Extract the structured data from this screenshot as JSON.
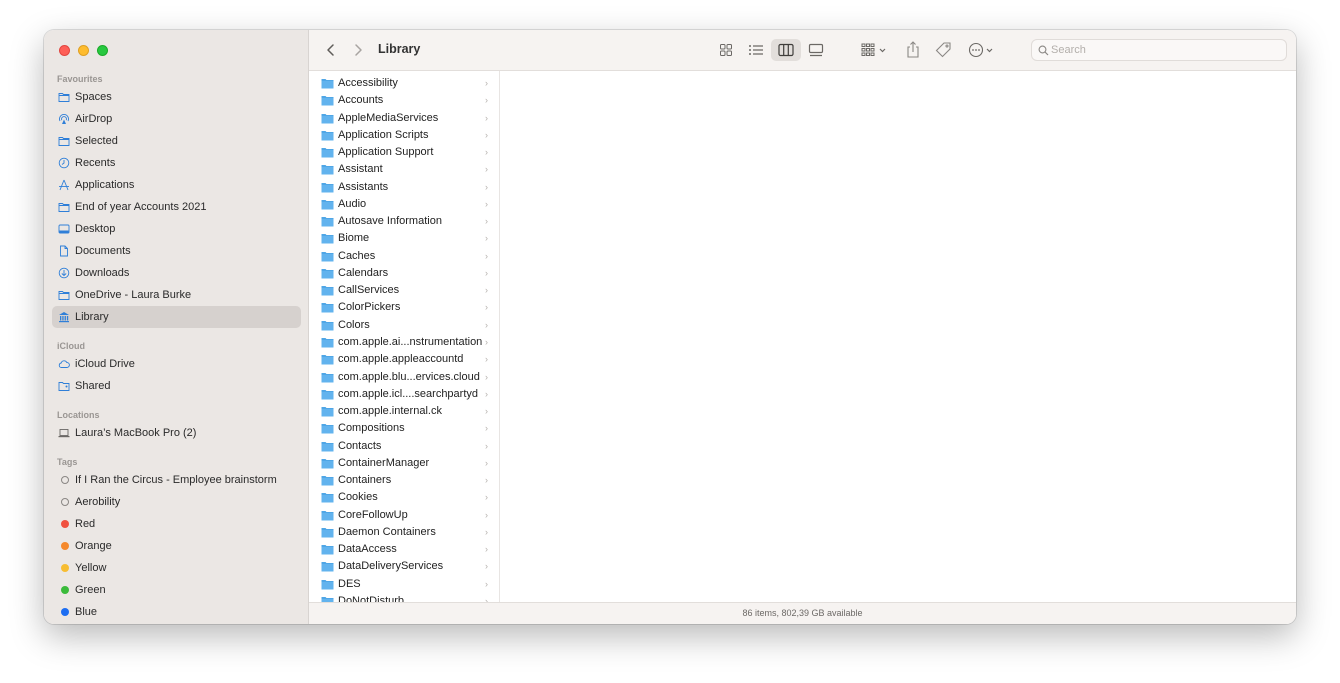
{
  "window": {
    "title": "Library"
  },
  "sidebar": {
    "favourites_heading": "Favourites",
    "favourites": [
      {
        "label": "Spaces",
        "icon": "folder-icon"
      },
      {
        "label": "AirDrop",
        "icon": "airdrop-icon"
      },
      {
        "label": "Selected",
        "icon": "folder-icon"
      },
      {
        "label": "Recents",
        "icon": "clock-icon"
      },
      {
        "label": "Applications",
        "icon": "applications-icon"
      },
      {
        "label": "End of year Accounts 2021",
        "icon": "folder-icon"
      },
      {
        "label": "Desktop",
        "icon": "desktop-icon"
      },
      {
        "label": "Documents",
        "icon": "document-icon"
      },
      {
        "label": "Downloads",
        "icon": "download-icon"
      },
      {
        "label": "OneDrive - Laura Burke",
        "icon": "folder-icon"
      },
      {
        "label": "Library",
        "icon": "library-icon",
        "active": true
      }
    ],
    "icloud_heading": "iCloud",
    "icloud": [
      {
        "label": "iCloud Drive",
        "icon": "cloud-icon"
      },
      {
        "label": "Shared",
        "icon": "shared-folder-icon"
      }
    ],
    "locations_heading": "Locations",
    "locations": [
      {
        "label": "Laura’s MacBook Pro (2)",
        "icon": "laptop-icon"
      }
    ],
    "tags_heading": "Tags",
    "tags": [
      {
        "label": "If I Ran the Circus - Employee brainstorm",
        "color": "hollow"
      },
      {
        "label": "Aerobility",
        "color": "hollow"
      },
      {
        "label": "Red",
        "color": "#f0513f"
      },
      {
        "label": "Orange",
        "color": "#f5892c"
      },
      {
        "label": "Yellow",
        "color": "#f7bd32"
      },
      {
        "label": "Green",
        "color": "#3bbb3b"
      },
      {
        "label": "Blue",
        "color": "#1d6ef2"
      }
    ]
  },
  "toolbar": {
    "back_icon": "chevron-left-icon",
    "forward_icon": "chevron-right-icon",
    "search_placeholder": "Search"
  },
  "column_items": [
    "Accessibility",
    "Accounts",
    "AppleMediaServices",
    "Application Scripts",
    "Application Support",
    "Assistant",
    "Assistants",
    "Audio",
    "Autosave Information",
    "Biome",
    "Caches",
    "Calendars",
    "CallServices",
    "ColorPickers",
    "Colors",
    "com.apple.ai...nstrumentation",
    "com.apple.appleaccountd",
    "com.apple.blu...ervices.cloud",
    "com.apple.icl....searchpartyd",
    "com.apple.internal.ck",
    "Compositions",
    "Contacts",
    "ContainerManager",
    "Containers",
    "Cookies",
    "CoreFollowUp",
    "Daemon Containers",
    "DataAccess",
    "DataDeliveryServices",
    "DES",
    "DoNotDisturb"
  ],
  "status": {
    "text": "86 items, 802,39 GB available"
  },
  "colors": {
    "folder": "#4fa6e6",
    "sidebar_bg": "#ebe7e4",
    "accent": "#2f7fd8"
  }
}
